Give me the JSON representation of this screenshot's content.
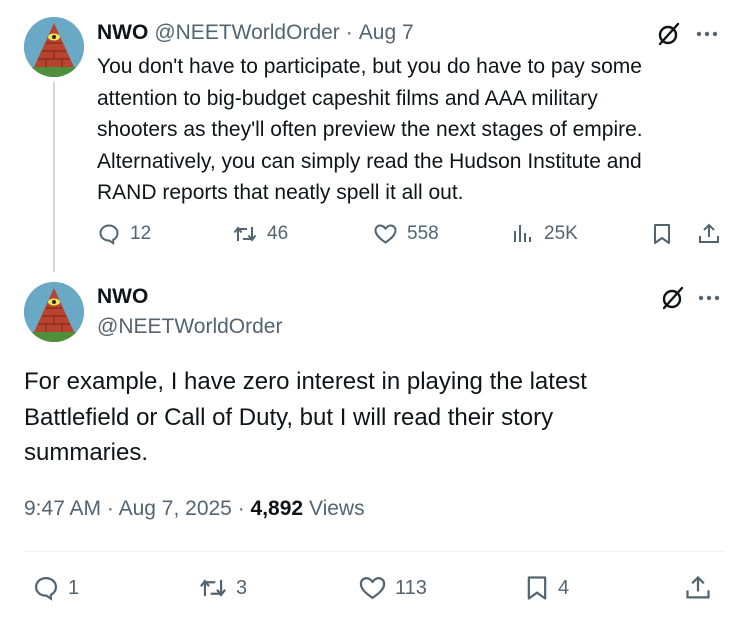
{
  "parent_tweet": {
    "author_name": "NWO",
    "author_handle": "@NEETWorldOrder",
    "separator": "·",
    "date": "Aug 7",
    "text": "You don't have to participate, but you do have to pay some\nattention to big-budget capeshit films and AAA military\nshooters as they'll often preview the next stages of empire.\nAlternatively, you can simply read the Hudson Institute and\nRAND reports that neatly spell it all out.",
    "replies": "12",
    "reposts": "46",
    "likes": "558",
    "views": "25K"
  },
  "main_tweet": {
    "author_name": "NWO",
    "author_handle": "@NEETWorldOrder",
    "text": "For example, I have zero interest in playing the latest\nBattlefield or Call of Duty, but I will read their story\nsummaries.",
    "time": "9:47 AM",
    "separator": "·",
    "date": "Aug 7, 2025",
    "view_count": "4,892",
    "views_label": "Views",
    "replies": "1",
    "reposts": "3",
    "likes": "113",
    "bookmarks": "4"
  },
  "icons": {
    "reply": "reply-bubble-icon",
    "repost": "repost-arrows-icon",
    "like": "heart-icon",
    "views": "bar-chart-icon",
    "bookmark": "bookmark-icon",
    "share": "share-upload-icon",
    "grok": "grok-slash-icon",
    "more": "more-dots-icon"
  },
  "colors": {
    "text": "#0f1419",
    "muted": "#536471",
    "thread_line": "#cfd9de",
    "divider": "#eff3f4"
  }
}
